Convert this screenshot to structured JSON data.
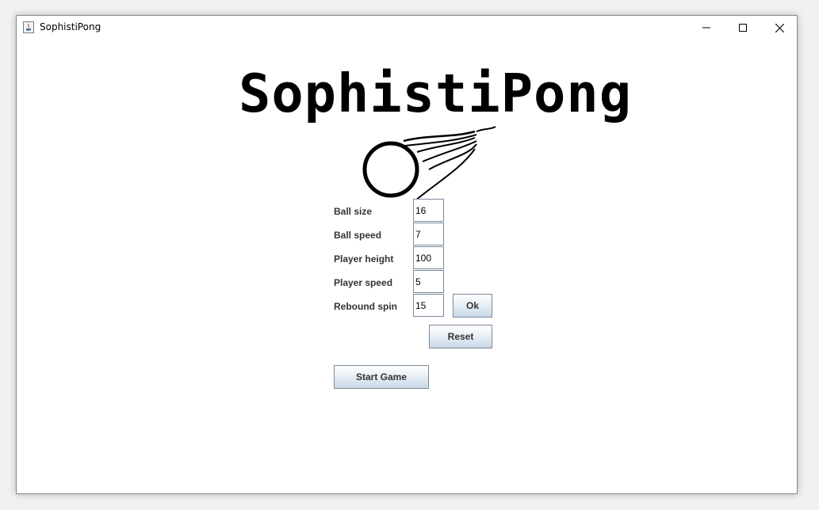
{
  "window": {
    "title": "SophistiPong",
    "controls": {
      "minimize": "minimize-icon",
      "maximize": "maximize-icon",
      "close": "close-icon"
    }
  },
  "logo": {
    "text": "SophistiPong",
    "graphic": "flaming-ball-icon"
  },
  "settings": {
    "ball_size": {
      "label": "Ball size",
      "value": "16"
    },
    "ball_speed": {
      "label": "Ball speed",
      "value": "7"
    },
    "player_height": {
      "label": "Player height",
      "value": "100"
    },
    "player_speed": {
      "label": "Player speed",
      "value": "5"
    },
    "rebound_spin": {
      "label": "Rebound spin",
      "value": "15"
    }
  },
  "buttons": {
    "ok": "Ok",
    "reset": "Reset",
    "start_game": "Start Game"
  },
  "colors": {
    "button_top": "#ffffff",
    "button_bottom": "#c9d7e6",
    "button_border": "#7a8a9b",
    "label": "#333333"
  }
}
